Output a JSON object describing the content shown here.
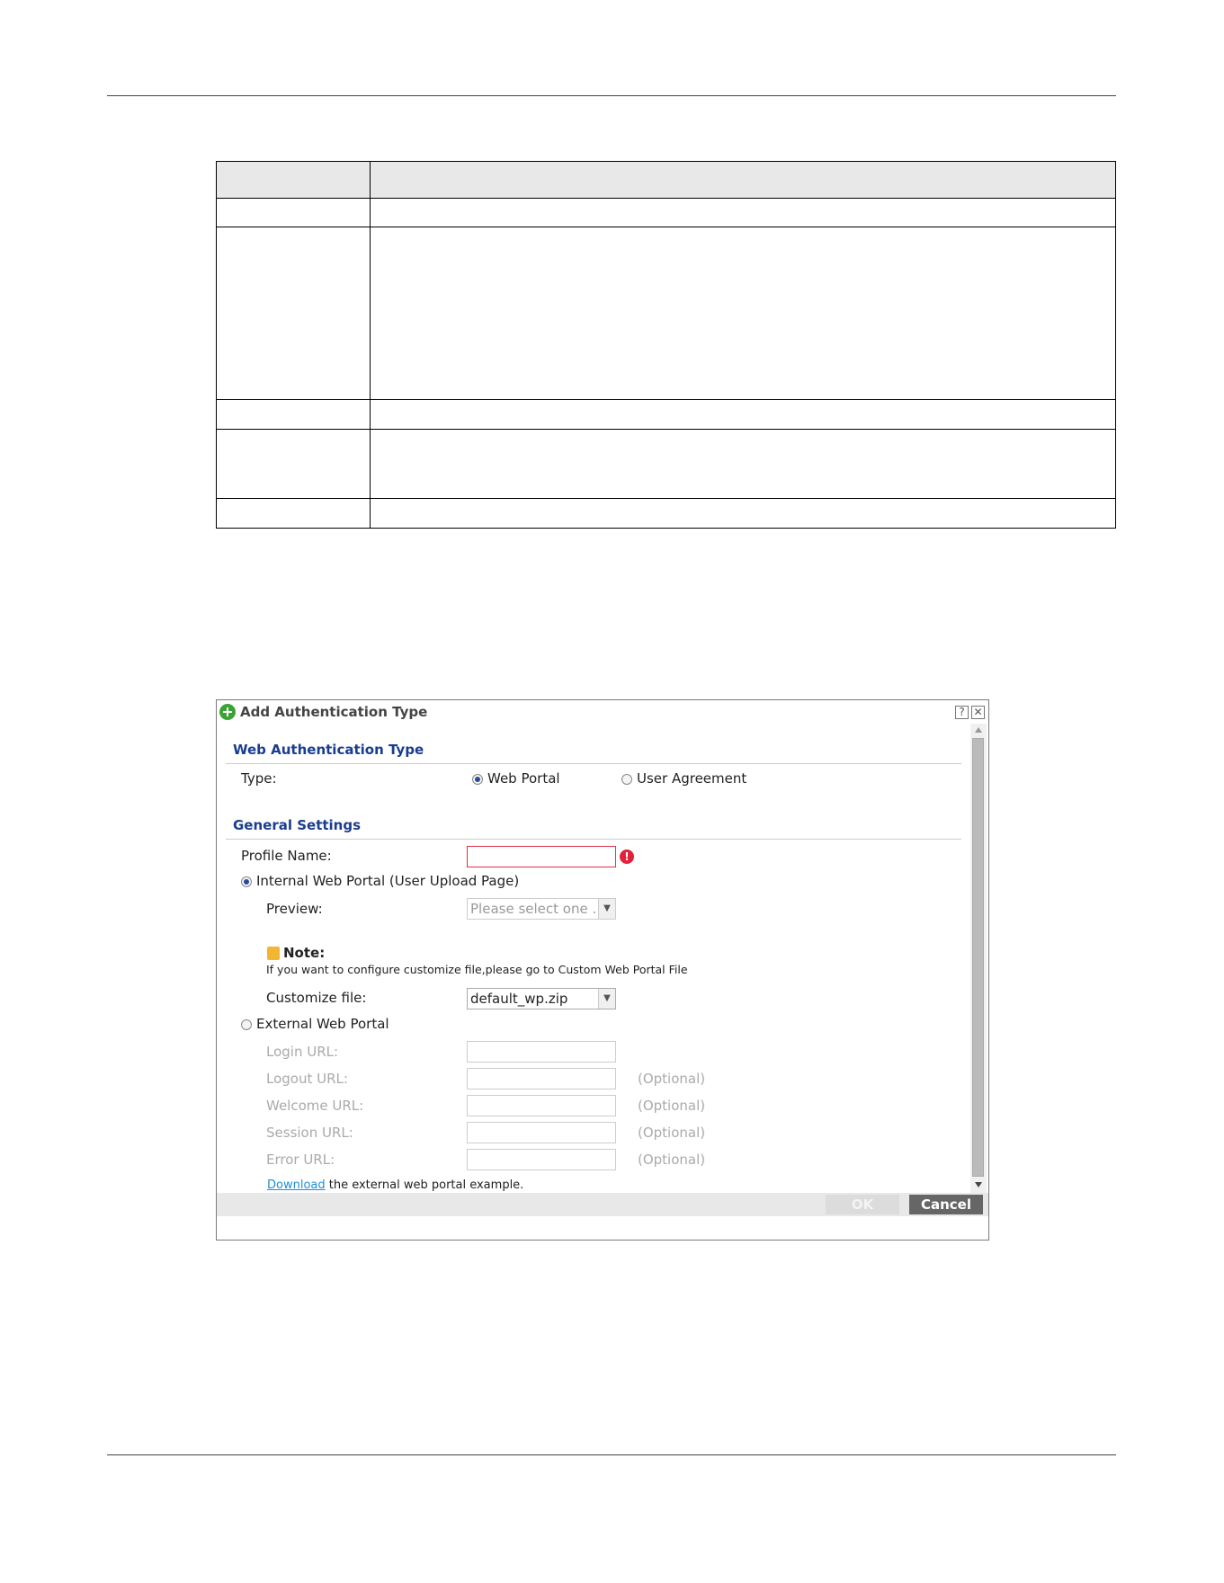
{
  "dialog": {
    "title": "Add Authentication Type",
    "help": "?",
    "close": "✕",
    "sections": {
      "web_auth": "Web Authentication Type",
      "general": "General Settings"
    },
    "type": {
      "label": "Type:",
      "options": [
        "Web Portal",
        "User Agreement"
      ],
      "selected": "Web Portal"
    },
    "profile_name": {
      "label": "Profile Name:",
      "value": "",
      "error_icon": "!"
    },
    "internal": {
      "label": "Internal Web Portal (User Upload Page)",
      "preview_label": "Preview:",
      "preview_value": "Please select one .",
      "note_title": "Note:",
      "note_text": "If you want to configure customize file,please go to Custom Web Portal File",
      "customize_label": "Customize file:",
      "customize_value": "default_wp.zip"
    },
    "external": {
      "label": "External Web Portal",
      "login_label": "Login URL:",
      "logout_label": "Logout URL:",
      "welcome_label": "Welcome URL:",
      "session_label": "Session URL:",
      "error_label": "Error URL:",
      "optional": "(Optional)",
      "download_link": "Download",
      "download_text": " the external web portal example."
    },
    "buttons": {
      "ok": "OK",
      "cancel": "Cancel"
    }
  }
}
